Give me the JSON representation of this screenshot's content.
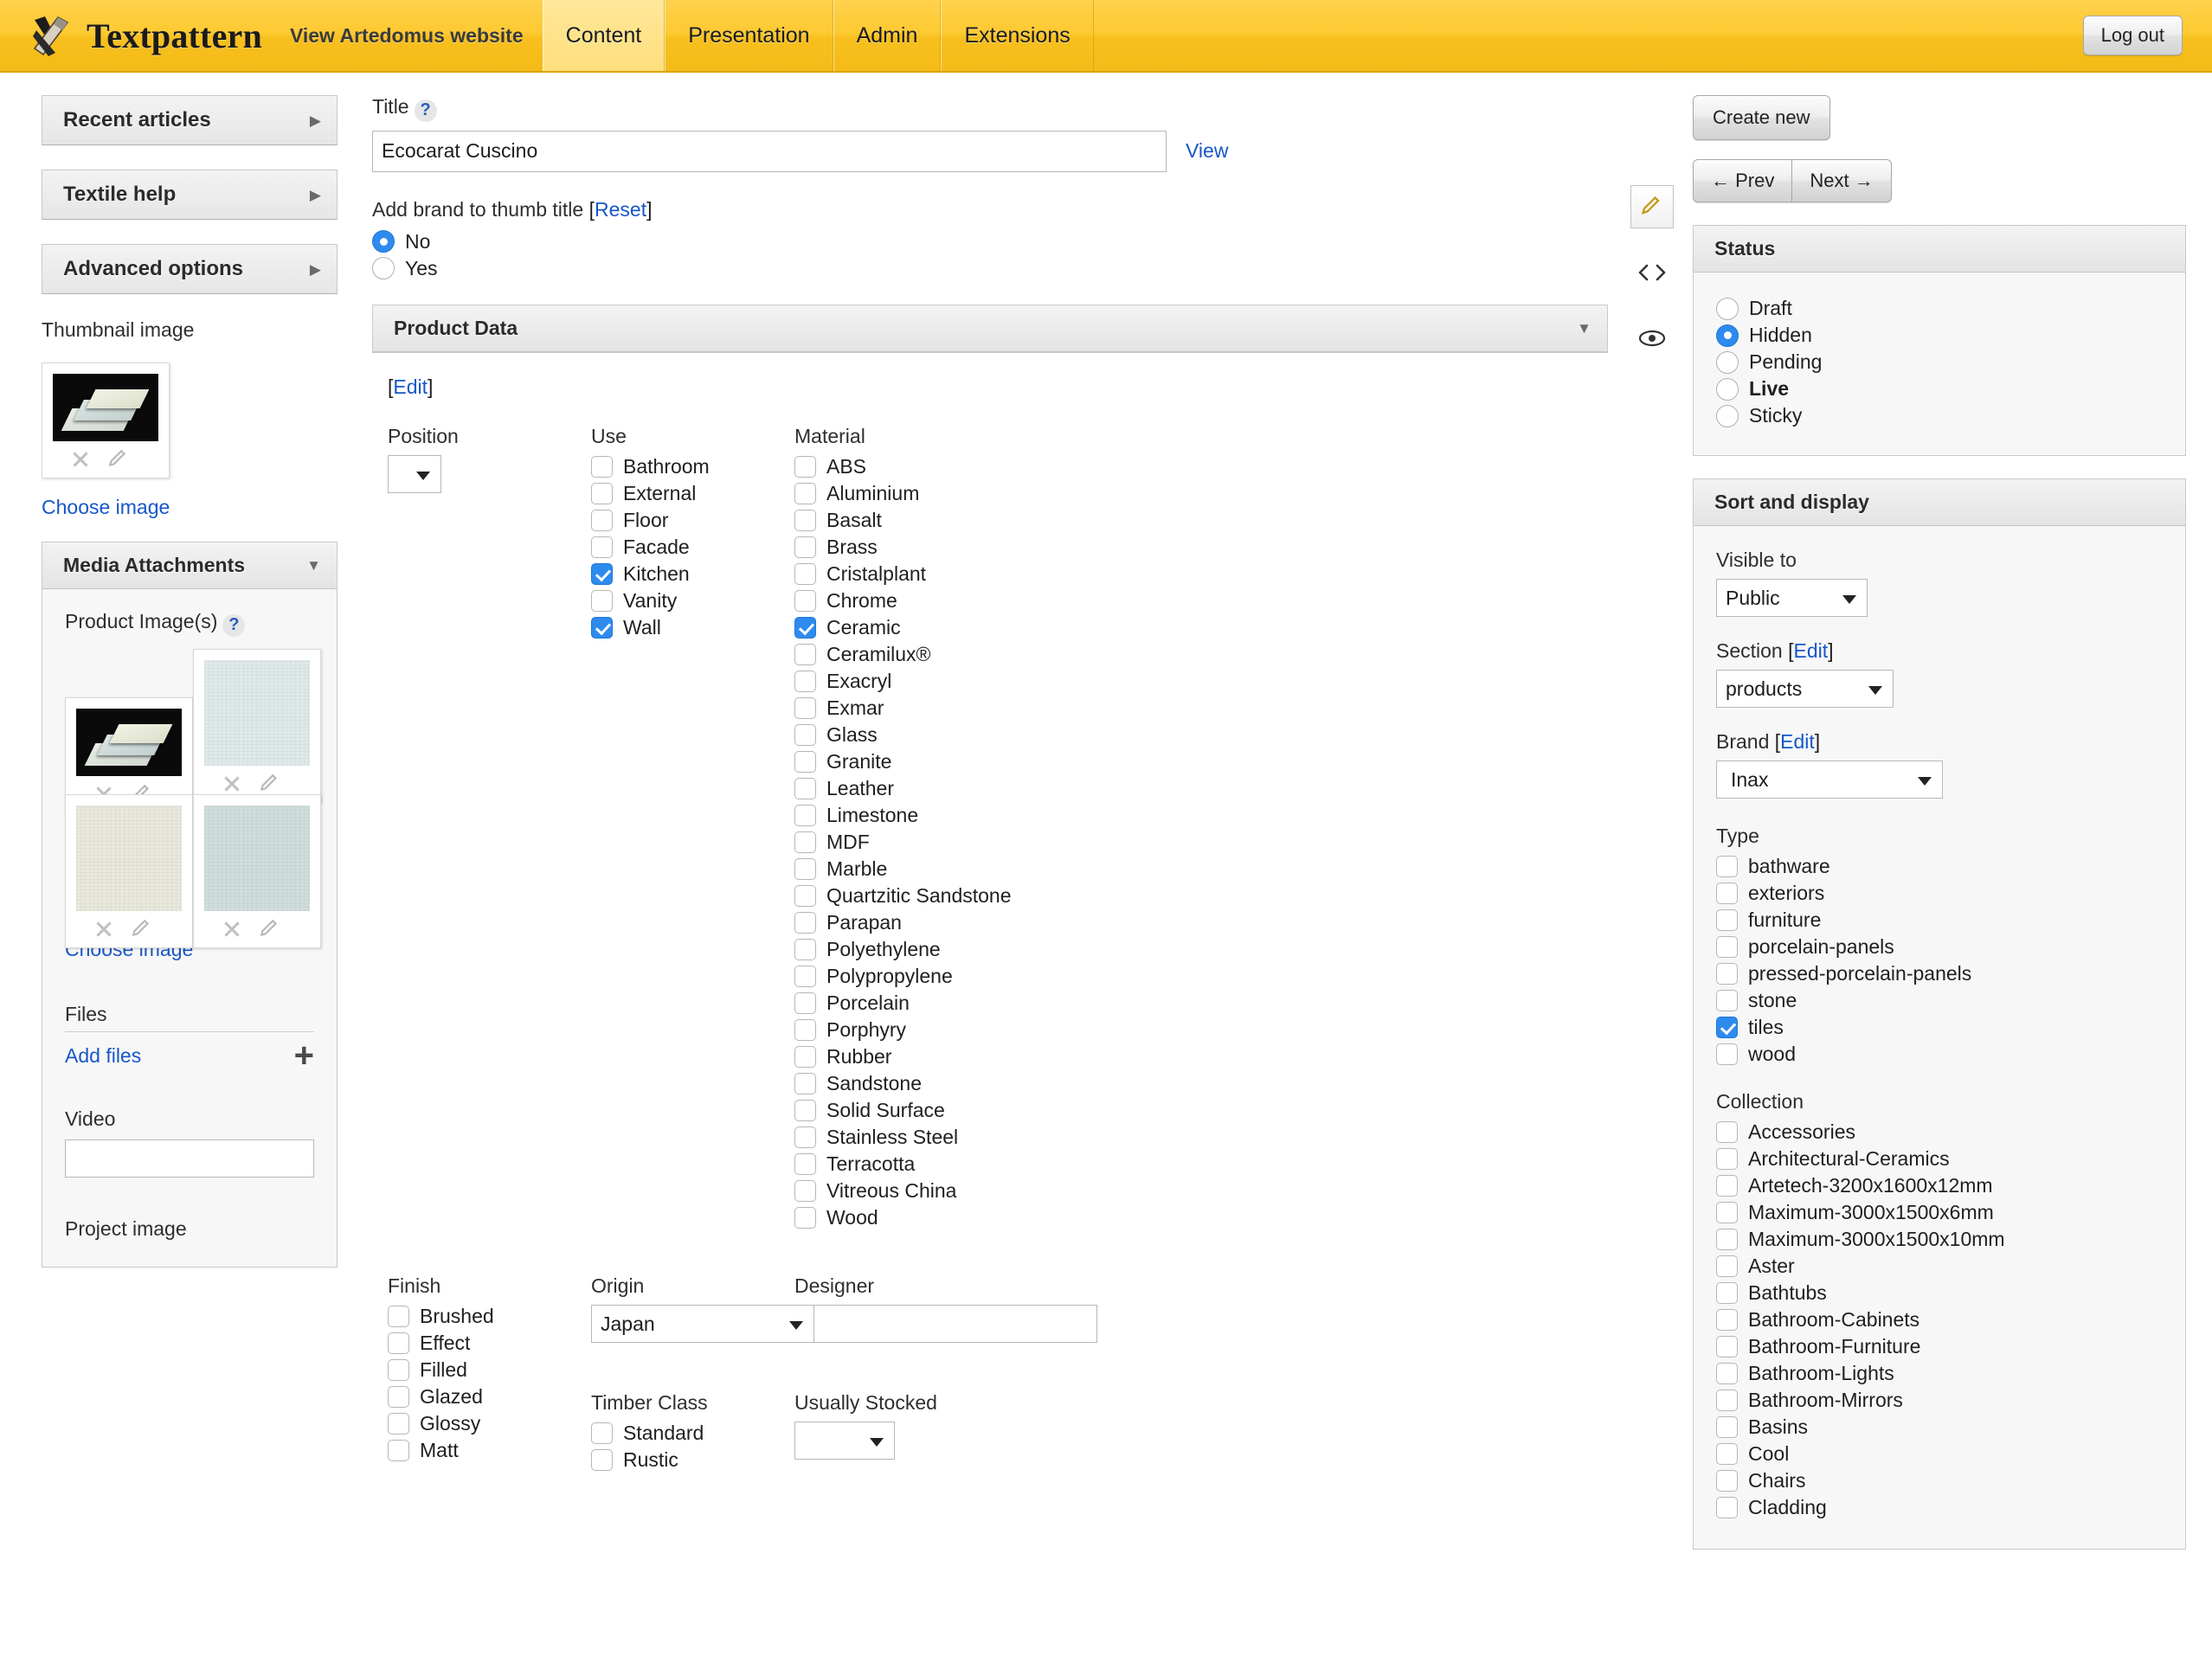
{
  "header": {
    "brand_name": "Textpattern",
    "logo_icon": "hammer-chisel-logo",
    "site_link": "View Artedomus website",
    "tabs": [
      {
        "label": "Content",
        "active": true
      },
      {
        "label": "Presentation",
        "active": false
      },
      {
        "label": "Admin",
        "active": false
      },
      {
        "label": "Extensions",
        "active": false
      }
    ],
    "logout_label": "Log out",
    "accent_color": "#fdc930"
  },
  "sidebar": {
    "twisters": [
      {
        "label": "Recent articles"
      },
      {
        "label": "Textile help"
      },
      {
        "label": "Advanced options"
      }
    ],
    "thumbnail": {
      "label": "Thumbnail image",
      "choose_link": "Choose image",
      "remove_icon": "close-icon",
      "edit_icon": "pencil-icon"
    },
    "media": {
      "panel_title": "Media Attachments",
      "product_images_label": "Product Image(s)",
      "help_icon": "help-icon",
      "images": [
        {
          "name": "ecocarat-tiles-black-bg",
          "style": "black"
        },
        {
          "name": "swatch-pale-blue",
          "style": "paleblue"
        },
        {
          "name": "swatch-cream",
          "style": "cream"
        },
        {
          "name": "swatch-blue-grey",
          "style": "bluegrey"
        }
      ],
      "choose_image_link": "Choose image",
      "files_label": "Files",
      "add_files_link": "Add files",
      "add_icon": "plus-icon",
      "video_label": "Video",
      "video_value": "",
      "project_image_label": "Project image"
    }
  },
  "main": {
    "title_label": "Title",
    "title_help_icon": "help-icon",
    "title_value": "Ecocarat Cuscino",
    "view_link": "View",
    "brand_thumb": {
      "label": "Add brand to thumb title",
      "reset_link": "[Reset]",
      "options": [
        {
          "label": "No",
          "selected": true
        },
        {
          "label": "Yes",
          "selected": false
        }
      ]
    },
    "product_data": {
      "panel_title": "Product Data",
      "collapse_icon": "chevron-down-icon",
      "edit_link": "[Edit]",
      "position": {
        "label": "Position",
        "value": ""
      },
      "use": {
        "label": "Use",
        "items": [
          {
            "label": "Bathroom",
            "checked": false
          },
          {
            "label": "External",
            "checked": false
          },
          {
            "label": "Floor",
            "checked": false
          },
          {
            "label": "Facade",
            "checked": false
          },
          {
            "label": "Kitchen",
            "checked": true
          },
          {
            "label": "Vanity",
            "checked": false
          },
          {
            "label": "Wall",
            "checked": true
          }
        ]
      },
      "material": {
        "label": "Material",
        "items": [
          {
            "label": "ABS",
            "checked": false
          },
          {
            "label": "Aluminium",
            "checked": false
          },
          {
            "label": "Basalt",
            "checked": false
          },
          {
            "label": "Brass",
            "checked": false
          },
          {
            "label": "Cristalplant",
            "checked": false
          },
          {
            "label": "Chrome",
            "checked": false
          },
          {
            "label": "Ceramic",
            "checked": true
          },
          {
            "label": "Ceramilux®",
            "checked": false
          },
          {
            "label": "Exacryl",
            "checked": false
          },
          {
            "label": "Exmar",
            "checked": false
          },
          {
            "label": "Glass",
            "checked": false
          },
          {
            "label": "Granite",
            "checked": false
          },
          {
            "label": "Leather",
            "checked": false
          },
          {
            "label": "Limestone",
            "checked": false
          },
          {
            "label": "MDF",
            "checked": false
          },
          {
            "label": "Marble",
            "checked": false
          },
          {
            "label": "Quartzitic Sandstone",
            "checked": false
          },
          {
            "label": "Parapan",
            "checked": false
          },
          {
            "label": "Polyethylene",
            "checked": false
          },
          {
            "label": "Polypropylene",
            "checked": false
          },
          {
            "label": "Porcelain",
            "checked": false
          },
          {
            "label": "Porphyry",
            "checked": false
          },
          {
            "label": "Rubber",
            "checked": false
          },
          {
            "label": "Sandstone",
            "checked": false
          },
          {
            "label": "Solid Surface",
            "checked": false
          },
          {
            "label": "Stainless Steel",
            "checked": false
          },
          {
            "label": "Terracotta",
            "checked": false
          },
          {
            "label": "Vitreous China",
            "checked": false
          },
          {
            "label": "Wood",
            "checked": false
          }
        ]
      },
      "finish": {
        "label": "Finish",
        "items": [
          {
            "label": "Brushed",
            "checked": false
          },
          {
            "label": "Effect",
            "checked": false
          },
          {
            "label": "Filled",
            "checked": false
          },
          {
            "label": "Glazed",
            "checked": false
          },
          {
            "label": "Glossy",
            "checked": false
          },
          {
            "label": "Matt",
            "checked": false
          }
        ]
      },
      "origin": {
        "label": "Origin",
        "value": "Japan"
      },
      "timber_class": {
        "label": "Timber Class",
        "items": [
          {
            "label": "Standard",
            "checked": false
          },
          {
            "label": "Rustic",
            "checked": false
          }
        ]
      },
      "designer": {
        "label": "Designer",
        "value": ""
      },
      "usually_stocked": {
        "label": "Usually Stocked",
        "value": ""
      }
    }
  },
  "rail": {
    "items": [
      {
        "icon": "pencil-icon",
        "name": "edit-view-button",
        "boxed": true
      },
      {
        "icon": "code-icon",
        "name": "source-view-button",
        "boxed": false
      },
      {
        "icon": "eye-icon",
        "name": "preview-button",
        "boxed": false
      }
    ]
  },
  "right": {
    "create_new_label": "Create new",
    "prev_label": "← Prev",
    "next_label": "Next →",
    "status": {
      "panel_title": "Status",
      "options": [
        {
          "label": "Draft",
          "selected": false,
          "bold": false
        },
        {
          "label": "Hidden",
          "selected": true,
          "bold": false
        },
        {
          "label": "Pending",
          "selected": false,
          "bold": false
        },
        {
          "label": "Live",
          "selected": false,
          "bold": true
        },
        {
          "label": "Sticky",
          "selected": false,
          "bold": false
        }
      ]
    },
    "sort_display": {
      "panel_title": "Sort and display",
      "visible_to": {
        "label": "Visible to",
        "value": "Public"
      },
      "section": {
        "label": "Section",
        "edit_link": "[Edit]",
        "value": "products"
      },
      "brand": {
        "label": "Brand",
        "edit_link": "[Edit]",
        "value": "Inax"
      },
      "type": {
        "label": "Type",
        "items": [
          {
            "label": "bathware",
            "checked": false
          },
          {
            "label": "exteriors",
            "checked": false
          },
          {
            "label": "furniture",
            "checked": false
          },
          {
            "label": "porcelain-panels",
            "checked": false
          },
          {
            "label": "pressed-porcelain-panels",
            "checked": false
          },
          {
            "label": "stone",
            "checked": false
          },
          {
            "label": "tiles",
            "checked": true
          },
          {
            "label": "wood",
            "checked": false
          }
        ]
      },
      "collection": {
        "label": "Collection",
        "items": [
          {
            "label": "Accessories",
            "checked": false
          },
          {
            "label": "Architectural-Ceramics",
            "checked": false
          },
          {
            "label": "Artetech-3200x1600x12mm",
            "checked": false
          },
          {
            "label": "Maximum-3000x1500x6mm",
            "checked": false
          },
          {
            "label": "Maximum-3000x1500x10mm",
            "checked": false
          },
          {
            "label": "Aster",
            "checked": false
          },
          {
            "label": "Bathtubs",
            "checked": false
          },
          {
            "label": "Bathroom-Cabinets",
            "checked": false
          },
          {
            "label": "Bathroom-Furniture",
            "checked": false
          },
          {
            "label": "Bathroom-Lights",
            "checked": false
          },
          {
            "label": "Bathroom-Mirrors",
            "checked": false
          },
          {
            "label": "Basins",
            "checked": false
          },
          {
            "label": "Cool",
            "checked": false
          },
          {
            "label": "Chairs",
            "checked": false
          },
          {
            "label": "Cladding",
            "checked": false
          }
        ]
      }
    }
  }
}
